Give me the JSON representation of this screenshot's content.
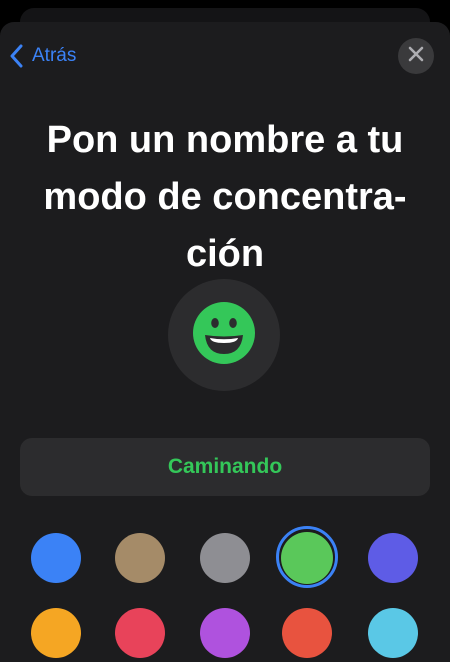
{
  "nav": {
    "back_label": "Atrás",
    "back_icon": "chevron-left-icon",
    "close_icon": "close-icon"
  },
  "title": "Pon un nombre a tu\nmodo de concentra-\nción",
  "focus_icon": {
    "name": "grinning-face-icon",
    "color": "#34c759"
  },
  "name_field": {
    "value": "Caminando",
    "color": "#34c759"
  },
  "colors": {
    "selected": "green",
    "accent": "#3b82f6",
    "swatches": [
      {
        "name": "blue",
        "hex": "#3b82f6"
      },
      {
        "name": "tan",
        "hex": "#a58b68"
      },
      {
        "name": "gray",
        "hex": "#8e8e93"
      },
      {
        "name": "green",
        "hex": "#5ac85a"
      },
      {
        "name": "indigo",
        "hex": "#5e5ce6"
      },
      {
        "name": "orange",
        "hex": "#f5a623"
      },
      {
        "name": "red",
        "hex": "#e8435a"
      },
      {
        "name": "purple",
        "hex": "#af52de"
      },
      {
        "name": "coral",
        "hex": "#e8533f"
      },
      {
        "name": "cyan",
        "hex": "#5ac8e6"
      }
    ]
  }
}
